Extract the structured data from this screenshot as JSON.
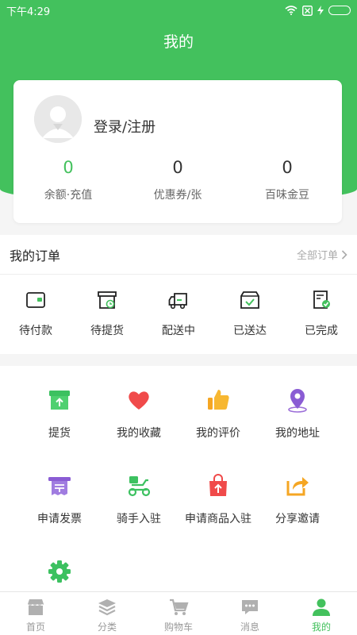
{
  "status": {
    "time": "下午4:29"
  },
  "header": {
    "title": "我的"
  },
  "profile": {
    "login_label": "登录/注册",
    "stats": [
      {
        "value": "0",
        "label": "余额·充值"
      },
      {
        "value": "0",
        "label": "优惠券/张"
      },
      {
        "value": "0",
        "label": "百味金豆"
      }
    ]
  },
  "orders": {
    "title": "我的订单",
    "all_label": "全部订单",
    "items": [
      {
        "label": "待付款",
        "icon": "wallet-icon"
      },
      {
        "label": "待提货",
        "icon": "pickup-box-icon"
      },
      {
        "label": "配送中",
        "icon": "truck-icon"
      },
      {
        "label": "已送达",
        "icon": "delivered-box-icon"
      },
      {
        "label": "已完成",
        "icon": "completed-doc-icon"
      }
    ]
  },
  "tools": [
    {
      "label": "提货",
      "icon": "pickup-icon"
    },
    {
      "label": "我的收藏",
      "icon": "heart-icon"
    },
    {
      "label": "我的评价",
      "icon": "thumbs-up-icon"
    },
    {
      "label": "我的地址",
      "icon": "location-pin-icon"
    },
    {
      "label": "申请发票",
      "icon": "invoice-icon"
    },
    {
      "label": "骑手入驻",
      "icon": "scooter-icon"
    },
    {
      "label": "申请商品入驻",
      "icon": "shopping-bag-icon"
    },
    {
      "label": "分享邀请",
      "icon": "share-icon"
    },
    {
      "label": "",
      "icon": "settings-gear-icon"
    }
  ],
  "tabbar": [
    {
      "label": "首页",
      "icon": "home-store-icon",
      "active": false
    },
    {
      "label": "分类",
      "icon": "layers-icon",
      "active": false
    },
    {
      "label": "购物车",
      "icon": "cart-icon",
      "active": false
    },
    {
      "label": "消息",
      "icon": "message-icon",
      "active": false
    },
    {
      "label": "我的",
      "icon": "user-icon",
      "active": true
    }
  ],
  "colors": {
    "primary": "#43c15d",
    "background": "#f5f5f5"
  }
}
